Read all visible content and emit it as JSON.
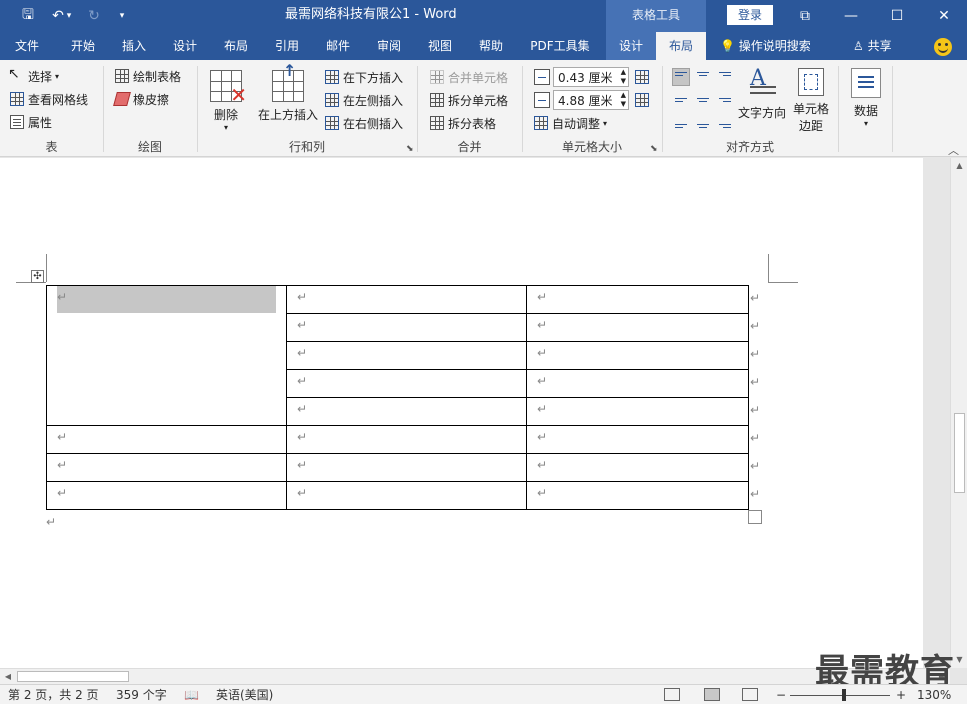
{
  "titlebar": {
    "doc_title": "最需网络科技有限公1  -  Word",
    "context_tools": "表格工具",
    "login": "登录",
    "save_glyph": "🖫",
    "undo_glyph": "↶",
    "undo_drop": "▾",
    "redo_glyph": "↻",
    "qa_more": "▾",
    "ribbon_display": "⧉",
    "minimize": "—",
    "maximize": "☐",
    "close": "✕"
  },
  "tabs": [
    {
      "label": "文件"
    },
    {
      "label": "开始"
    },
    {
      "label": "插入"
    },
    {
      "label": "设计"
    },
    {
      "label": "布局"
    },
    {
      "label": "引用"
    },
    {
      "label": "邮件"
    },
    {
      "label": "审阅"
    },
    {
      "label": "视图"
    },
    {
      "label": "帮助"
    },
    {
      "label": "PDF工具集"
    },
    {
      "label": "设计"
    },
    {
      "label": "布局"
    }
  ],
  "tell_me": "💡  操作说明搜索",
  "share": "♙ 共享",
  "ribbon": {
    "groups": {
      "table": "表",
      "draw": "绘图",
      "rows_cols": "行和列",
      "merge": "合并",
      "cell_size": "单元格大小",
      "alignment": "对齐方式"
    },
    "table": {
      "select": "选择",
      "view_gridlines": "查看网格线",
      "properties": "属性"
    },
    "draw": {
      "draw_table": "绘制表格",
      "eraser": "橡皮擦"
    },
    "rows_cols": {
      "delete": "删除",
      "insert_above": "在上方插入",
      "insert_below": "在下方插入",
      "insert_left": "在左侧插入",
      "insert_right": "在右侧插入"
    },
    "merge": {
      "merge_cells": "合并单元格",
      "split_cells": "拆分单元格",
      "split_table": "拆分表格"
    },
    "cell_size": {
      "height": "0.43 厘米",
      "width": "4.88 厘米",
      "autofit": "自动调整"
    },
    "alignment": {
      "text_direction": "文字方向",
      "cell_margins_1": "单元格",
      "cell_margins_2": "边距"
    },
    "data": {
      "label": "数据"
    }
  },
  "document": {
    "para_mark": "↵",
    "table_rows": [
      [
        "↵",
        "↵",
        "↵"
      ],
      [
        "",
        "↵",
        "↵"
      ],
      [
        "",
        "↵",
        "↵"
      ],
      [
        "",
        "↵",
        "↵"
      ],
      [
        "",
        "↵",
        "↵"
      ],
      [
        "↵",
        "↵",
        "↵"
      ],
      [
        "↵",
        "↵",
        "↵"
      ],
      [
        "↵",
        "↵",
        "↵"
      ]
    ]
  },
  "watermark": "最需教育",
  "status": {
    "page": "第 2 页，共 2 页",
    "words": "359 个字",
    "language": "英语(美国)",
    "zoom_minus": "−",
    "zoom_plus": "+",
    "zoom": "130%"
  }
}
